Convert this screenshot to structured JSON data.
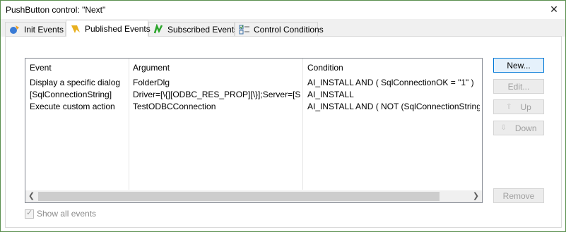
{
  "window": {
    "title": "PushButton control: \"Next\"",
    "close_icon": "close-icon"
  },
  "tabs": [
    {
      "label": "Init Events",
      "icon": "init-events-icon",
      "active": false
    },
    {
      "label": "Published Events",
      "icon": "published-events-icon",
      "active": true
    },
    {
      "label": "Subscribed Events",
      "icon": "subscribed-events-icon",
      "active": false
    },
    {
      "label": "Control Conditions",
      "icon": "control-conditions-icon",
      "active": false
    }
  ],
  "grid": {
    "headers": [
      "Event",
      "Argument",
      "Condition"
    ],
    "rows": [
      [
        "Display a specific dialog",
        "FolderDlg",
        "AI_INSTALL AND ( SqlConnectionOK = \"1\" )"
      ],
      [
        "[SqlConnectionString]",
        "Driver=[\\{][ODBC_RES_PROP][\\}];Server=[SERV",
        "AI_INSTALL"
      ],
      [
        "Execute custom action",
        "TestODBCConnection",
        "AI_INSTALL AND ( NOT (SqlConnectionString = \"\") )"
      ]
    ]
  },
  "buttons": {
    "new": "New...",
    "edit": "Edit...",
    "up": "Up",
    "down": "Down",
    "remove": "Remove"
  },
  "show_all_events": {
    "label": "Show all events",
    "checked": true,
    "enabled": false
  },
  "colors": {
    "accent": "#0078d7",
    "window_border": "#5a8f4e"
  }
}
